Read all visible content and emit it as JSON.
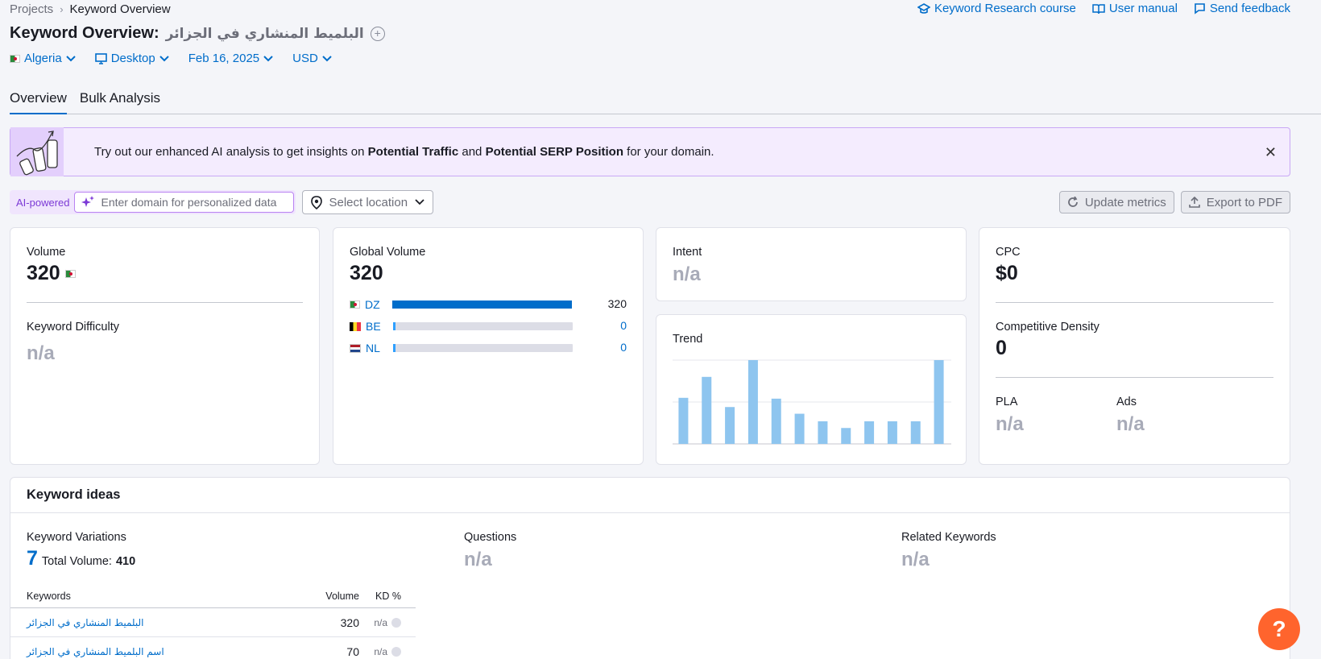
{
  "breadcrumb": {
    "projects": "Projects",
    "current": "Keyword Overview"
  },
  "top_links": {
    "course": "Keyword Research course",
    "manual": "User manual",
    "feedback": "Send feedback"
  },
  "title": {
    "prefix": "Keyword Overview:",
    "keyword": "البلميط المنشاري في الجزائر"
  },
  "filters": {
    "country": "Algeria",
    "device": "Desktop",
    "date": "Feb 16, 2025",
    "currency": "USD"
  },
  "tabs": [
    {
      "label": "Overview",
      "active": true
    },
    {
      "label": "Bulk Analysis",
      "active": false
    }
  ],
  "banner": {
    "text_1": "Try out our enhanced AI analysis to get insights on ",
    "bold_1": "Potential Traffic",
    "text_2": " and ",
    "bold_2": "Potential SERP Position",
    "text_3": " for your domain."
  },
  "tools": {
    "ai_label": "AI-powered",
    "domain_placeholder": "Enter domain for personalized data",
    "location_placeholder": "Select location",
    "update_button": "Update metrics",
    "export_button": "Export to PDF"
  },
  "volume_card": {
    "label": "Volume",
    "value": "320",
    "kd_label": "Keyword Difficulty",
    "kd_value": "n/a"
  },
  "global_volume_card": {
    "label": "Global Volume",
    "value": "320",
    "rows": [
      {
        "code": "DZ",
        "value": "320",
        "share": 1.0
      },
      {
        "code": "BE",
        "value": "0",
        "share": 0.0
      },
      {
        "code": "NL",
        "value": "0",
        "share": 0.0
      }
    ]
  },
  "intent_card": {
    "label": "Intent",
    "value": "n/a"
  },
  "trend_card": {
    "label": "Trend"
  },
  "chart_data": {
    "type": "bar",
    "title": "Trend",
    "categories": [
      "1",
      "2",
      "3",
      "4",
      "5",
      "6",
      "7",
      "8",
      "9",
      "10",
      "11",
      "12"
    ],
    "values": [
      0.55,
      0.8,
      0.44,
      1.0,
      0.54,
      0.36,
      0.27,
      0.19,
      0.27,
      0.27,
      0.27,
      1.0
    ],
    "ylim": [
      0,
      1
    ],
    "grid": true,
    "color": "#8ec5ef"
  },
  "cpc_card": {
    "label": "CPC",
    "value": "$0",
    "cd_label": "Competitive Density",
    "cd_value": "0",
    "pla_label": "PLA",
    "pla_value": "n/a",
    "ads_label": "Ads",
    "ads_value": "n/a"
  },
  "keyword_ideas": {
    "header": "Keyword ideas",
    "variations_label": "Keyword Variations",
    "variations_count": "7",
    "total_volume_label": "Total Volume:",
    "total_volume": "410",
    "questions_label": "Questions",
    "questions_value": "n/a",
    "related_label": "Related Keywords",
    "related_value": "n/a",
    "table": {
      "headers": [
        "Keywords",
        "Volume",
        "KD %"
      ],
      "rows": [
        {
          "keyword": "البلميط المنشاري في الجزائر",
          "volume": "320",
          "kd": "n/a"
        },
        {
          "keyword": "اسم البلميط المنشاري في الجزائر",
          "volume": "70",
          "kd": "n/a"
        }
      ]
    }
  },
  "help_button": "?",
  "colors": {
    "accent": "#006dca",
    "help": "#ff642d",
    "ai": "#7c3ad6",
    "bar": "#8ec5ef"
  }
}
